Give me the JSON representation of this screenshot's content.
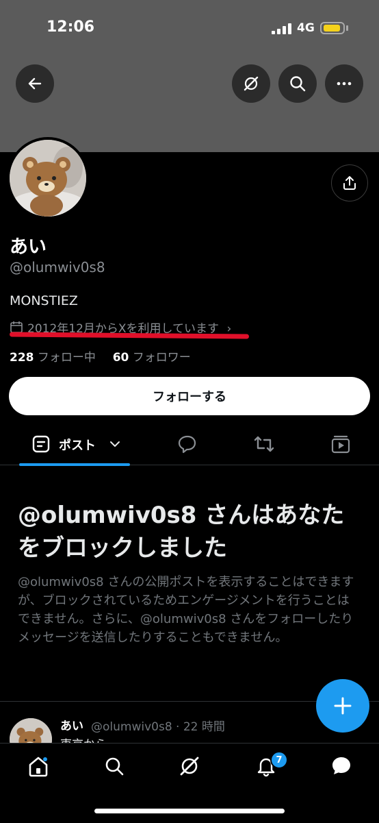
{
  "status_bar": {
    "time": "12:06",
    "network": "4G"
  },
  "header": {
    "back_icon": "arrow-left-icon",
    "grok_icon": "grok-icon",
    "search_icon": "search-icon",
    "more_icon": "more-icon"
  },
  "profile": {
    "name": "あい",
    "handle": "@olumwiv0s8",
    "bio": "MONSTIEZ",
    "joined": "2012年12月からXを利用しています",
    "following_count": "228",
    "following_label": "フォロー中",
    "followers_count": "60",
    "followers_label": "フォロワー",
    "follow_button": "フォローする"
  },
  "tabs": {
    "active_label": "ポスト"
  },
  "blocked": {
    "title": "@olumwiv0s8 さんはあなたをブロックしました",
    "body": "@olumwiv0s8 さんの公開ポストを表示することはできますが、ブロックされているためエンゲージメントを行うことはできません。さらに、@olumwiv0s8 さんをフォローしたりメッセージを送信したりすることもできません。"
  },
  "post": {
    "author": "あい",
    "meta": "@olumwiv0s8 · 22 時間",
    "text": "東京から"
  },
  "bottom_nav": {
    "notification_badge": "7"
  },
  "colors": {
    "accent": "#1d9bf0",
    "annotation_red": "#e0102a"
  }
}
